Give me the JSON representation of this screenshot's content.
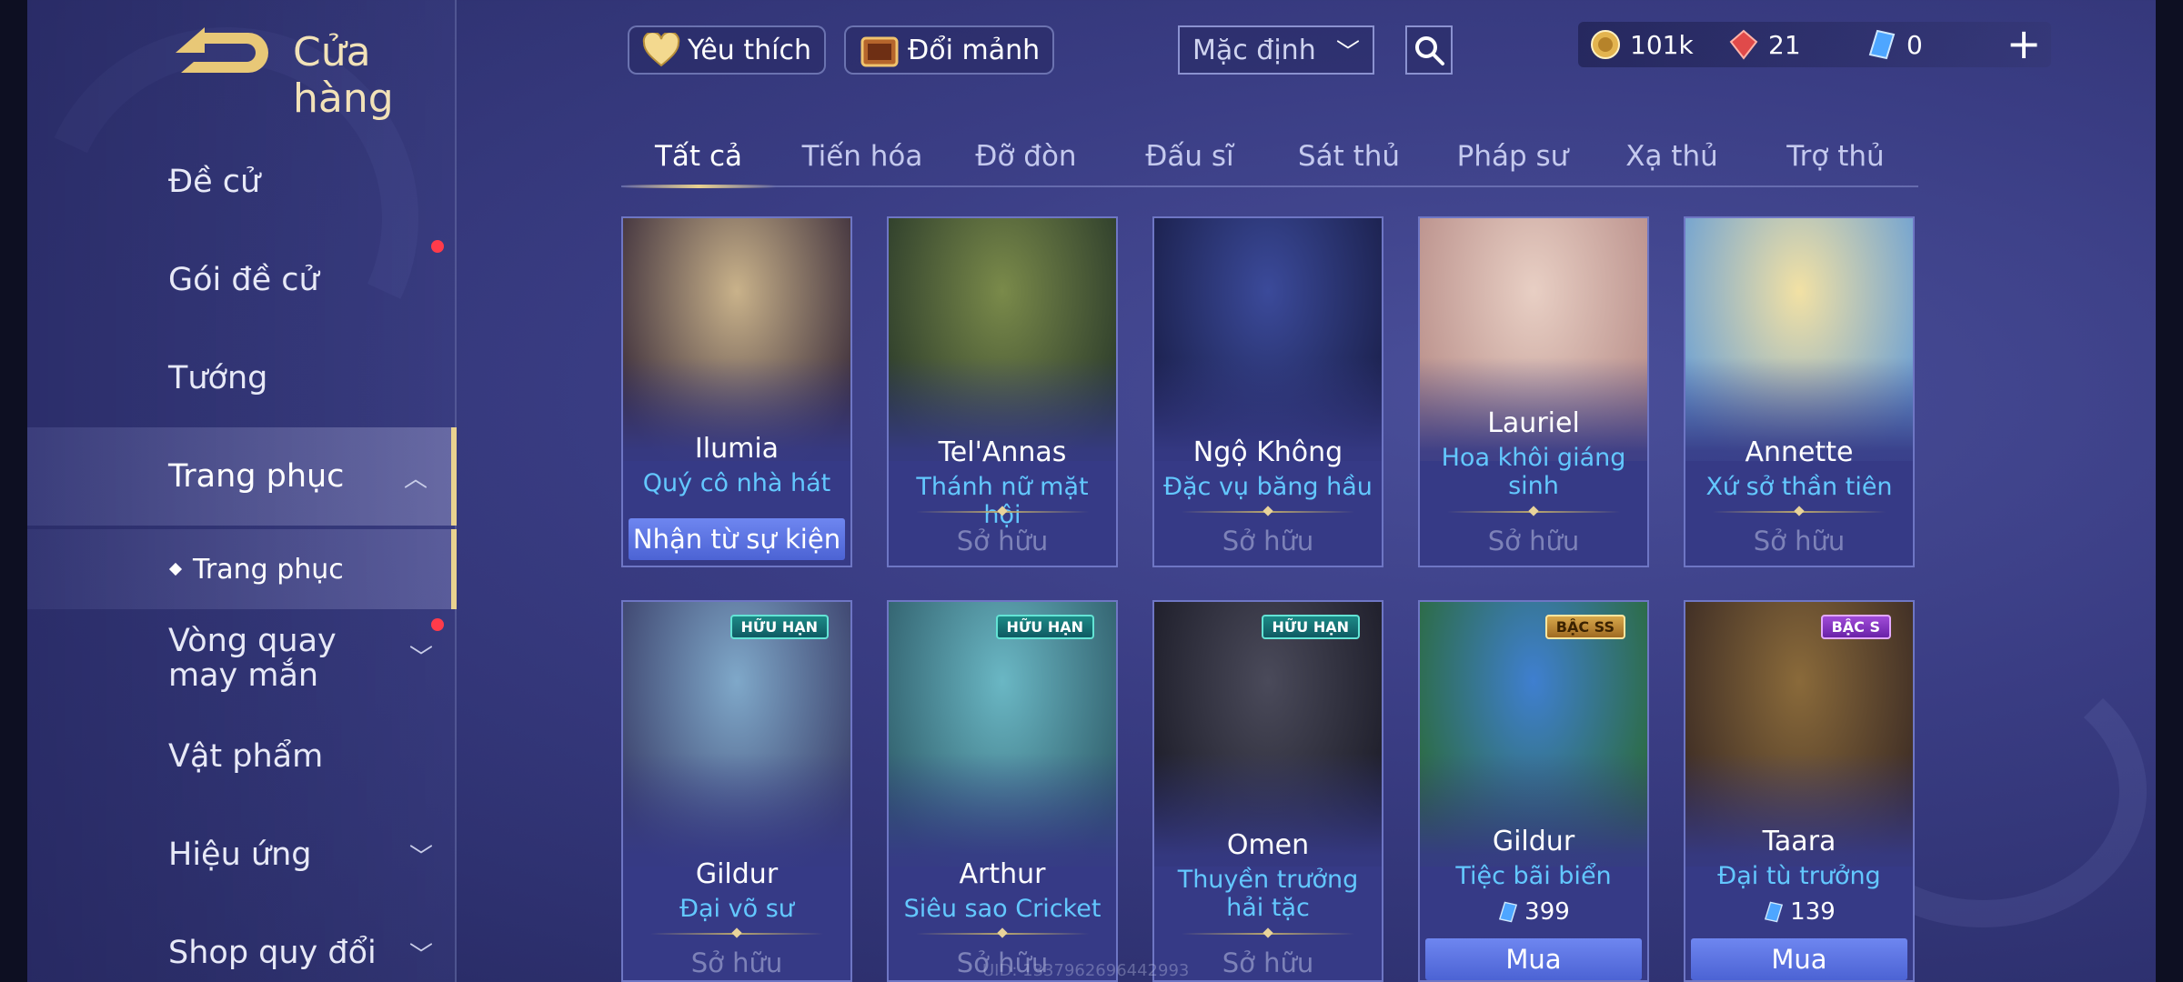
{
  "header": {
    "title": "Cửa hàng",
    "favorite_label": "Yêu thích",
    "exchange_label": "Đổi mảnh",
    "sort_selected": "Mặc định",
    "currencies": [
      {
        "icon": "gold-coin-icon",
        "value": "101k"
      },
      {
        "icon": "red-gem-icon",
        "value": "21"
      },
      {
        "icon": "blue-crystal-icon",
        "value": "0"
      }
    ],
    "plus_label": "+"
  },
  "sidebar": {
    "items": [
      {
        "label": "Đề cử"
      },
      {
        "label": "Gói đề cử"
      },
      {
        "label": "Tướng"
      },
      {
        "label": "Trang phục"
      },
      {
        "label": "Vòng quay may mắn"
      },
      {
        "label": "Vật phẩm"
      },
      {
        "label": "Hiệu ứng"
      },
      {
        "label": "Shop quy đổi"
      }
    ],
    "sub_item": "Trang phục"
  },
  "tabs": [
    "Tất cả",
    "Tiến hóa",
    "Đỡ đòn",
    "Đấu sĩ",
    "Sát thủ",
    "Pháp sư",
    "Xạ thủ",
    "Trợ thủ"
  ],
  "cards": [
    {
      "hero": "Ilumia",
      "skin": "Quý cô nhà hát",
      "status": "Nhận từ sự kiện",
      "colors": [
        "#c9b28a",
        "#3a2c3a"
      ]
    },
    {
      "hero": "Tel'Annas",
      "skin": "Thánh nữ mặt hội",
      "status": "Sở hữu",
      "colors": [
        "#7a8a4a",
        "#2a3a2a"
      ]
    },
    {
      "hero": "Ngộ Không",
      "skin": "Đặc vụ băng hầu",
      "status": "Sở hữu",
      "colors": [
        "#3b4a9a",
        "#1a1f4a"
      ]
    },
    {
      "hero": "Lauriel",
      "skin": "Hoa khôi giáng sinh",
      "status": "Sở hữu",
      "colors": [
        "#e8cfc4",
        "#b98f8a"
      ]
    },
    {
      "hero": "Annette",
      "skin": "Xứ sở thần tiên",
      "status": "Sở hữu",
      "colors": [
        "#f2e1a4",
        "#6a9fd4"
      ]
    },
    {
      "hero": "Gildur",
      "skin": "Đại võ sư",
      "status": "Sở hữu",
      "badge": "HỮU HẠN",
      "colors": [
        "#7fa8c9",
        "#3a3f6a"
      ]
    },
    {
      "hero": "Arthur",
      "skin": "Siêu sao Cricket",
      "status": "Sở hữu",
      "badge": "HỮU HẠN",
      "colors": [
        "#6ab7c4",
        "#2f5d6a"
      ]
    },
    {
      "hero": "Omen",
      "skin": "Thuyền trưởng hải tặc",
      "status": "Sở hữu",
      "badge": "HỮU HẠN",
      "colors": [
        "#4a4a5a",
        "#1c1c28"
      ]
    },
    {
      "hero": "Gildur",
      "skin": "Tiệc bãi biển",
      "price": "399",
      "action": "Mua",
      "badge": "BẬC SS",
      "colors": [
        "#3f7fd0",
        "#2b6a3a"
      ]
    },
    {
      "hero": "Taara",
      "skin": "Đại tù trưởng",
      "price": "139",
      "action": "Mua",
      "badge": "BẬC S",
      "colors": [
        "#8a6a3a",
        "#3a2a24"
      ]
    }
  ],
  "watermark": "UID: 1337962696442993",
  "colors": {
    "accent_gold": "#e9d28f",
    "skin_blue": "#63c8ff",
    "button_blue": "#5a72e0",
    "notify_red": "#ff3b4a"
  }
}
